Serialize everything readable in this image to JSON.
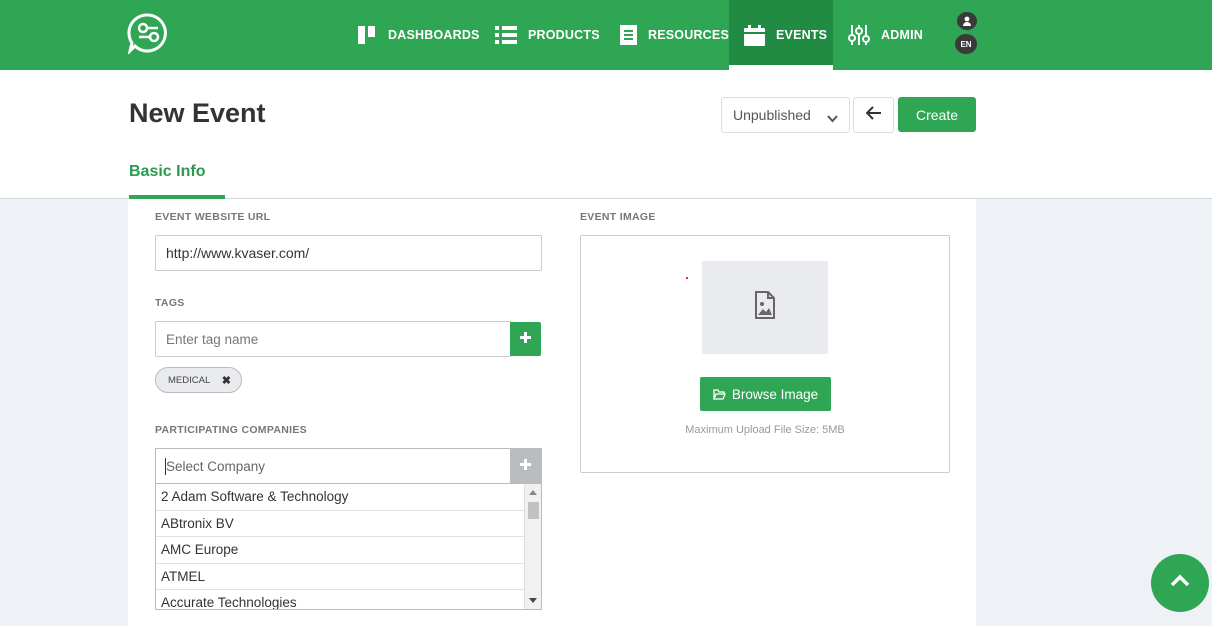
{
  "nav": {
    "items": [
      {
        "label": "DASHBOARDS",
        "icon": "dashboard-icon"
      },
      {
        "label": "PRODUCTS",
        "icon": "list-icon"
      },
      {
        "label": "RESOURCES",
        "icon": "document-icon"
      },
      {
        "label": "EVENTS",
        "icon": "calendar-icon",
        "active": true
      },
      {
        "label": "ADMIN",
        "icon": "sliders-icon"
      }
    ],
    "lang": "EN",
    "brand_color": "#2ea653"
  },
  "page": {
    "title": "New Event",
    "status": "Unpublished",
    "create_label": "Create",
    "tab": "Basic Info"
  },
  "form": {
    "website": {
      "label": "EVENT WEBSITE URL",
      "value": "http://www.kvaser.com/"
    },
    "tags": {
      "label": "TAGS",
      "placeholder": "Enter tag name",
      "items": [
        "MEDICAL"
      ]
    },
    "companies": {
      "label": "PARTICIPATING COMPANIES",
      "placeholder": "Select Company",
      "options": [
        "2 Adam Software & Technology",
        "ABtronix BV",
        "AMC Europe",
        "ATMEL",
        "Accurate Technologies"
      ]
    },
    "image": {
      "label": "EVENT IMAGE",
      "browse_label": "Browse Image",
      "hint": "Maximum Upload File Size: 5MB"
    }
  }
}
